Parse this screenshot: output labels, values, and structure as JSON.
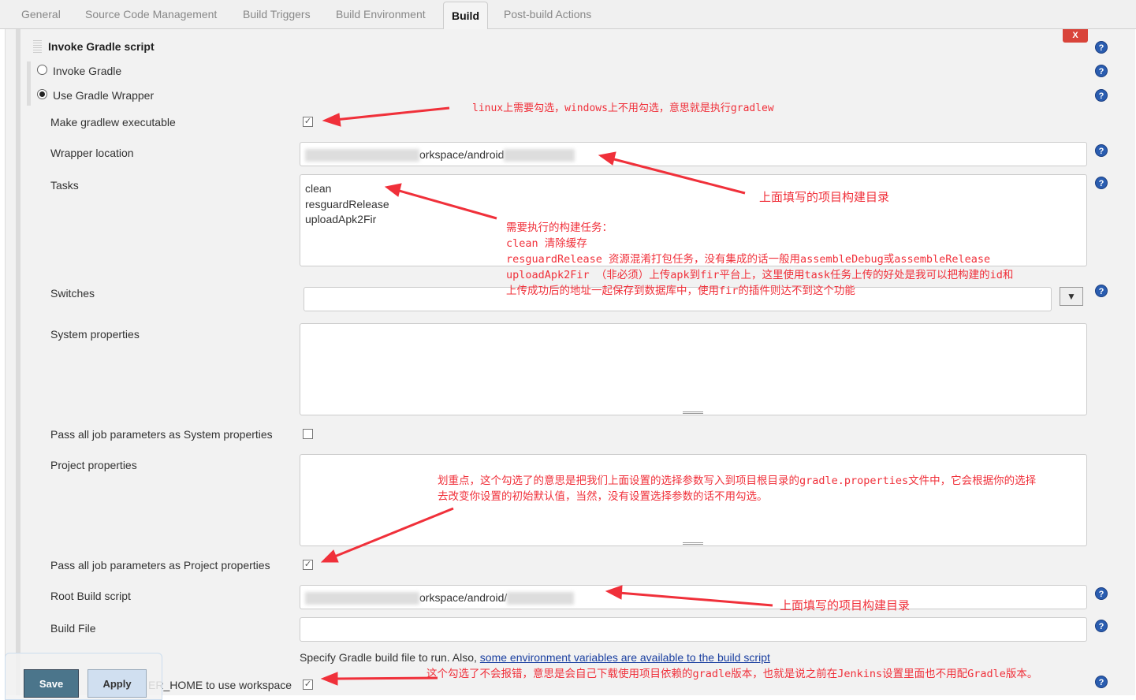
{
  "tabs": [
    {
      "label": "General"
    },
    {
      "label": "Source Code Management"
    },
    {
      "label": "Build Triggers"
    },
    {
      "label": "Build Environment"
    },
    {
      "label": "Build",
      "active": true
    },
    {
      "label": "Post-build Actions"
    }
  ],
  "section": {
    "title": "Invoke Gradle script",
    "delete_label": "X"
  },
  "radios": {
    "invoke_gradle": "Invoke Gradle",
    "use_wrapper": "Use Gradle Wrapper",
    "selected": "use_wrapper"
  },
  "fields": {
    "make_executable": {
      "label": "Make gradlew executable",
      "checked": true
    },
    "wrapper_location": {
      "label": "Wrapper location",
      "value": "orkspace/android"
    },
    "tasks": {
      "label": "Tasks",
      "lines": [
        "clean",
        "resguardRelease",
        "uploadApk2Fir"
      ]
    },
    "switches": {
      "label": "Switches",
      "value": ""
    },
    "system_properties": {
      "label": "System properties",
      "value": ""
    },
    "pass_system": {
      "label": "Pass all job parameters as System properties",
      "checked": false
    },
    "project_properties": {
      "label": "Project properties",
      "value": ""
    },
    "pass_project": {
      "label": "Pass all job parameters as Project properties",
      "checked": true
    },
    "root_build_script": {
      "label": "Root Build script",
      "value": "orkspace/android/"
    },
    "build_file": {
      "label": "Build File",
      "value": ""
    },
    "build_file_help": "Specify Gradle build file to run. Also, ",
    "build_file_link": "some environment variables are available to the build script",
    "gradle_home": {
      "label": "ER_HOME to use workspace",
      "checked": true
    }
  },
  "buttons": {
    "save": "Save",
    "apply": "Apply"
  },
  "annotations": {
    "linux": "linux上需要勾选，windows上不用勾选，意思就是执行gradlew",
    "wrapper_dir": "上面填写的项目构建目录",
    "tasks": [
      "需要执行的构建任务：",
      "clean 清除缓存",
      "resguardRelease 资源混淆打包任务，没有集成的话一般用assembleDebug或assembleRelease",
      "uploadApk2Fir （非必须）上传apk到fir平台上，这里使用task任务上传的好处是我可以把构建的id和",
      "上传成功后的地址一起保存到数据库中，使用fir的插件则达不到这个功能"
    ],
    "project_props": [
      "划重点，这个勾选了的意思是把我们上面设置的选择参数写入到项目根目录的gradle.properties文件中，它会根据你的选择",
      "去改变你设置的初始默认值，当然，没有设置选择参数的话不用勾选。"
    ],
    "root_dir": "上面填写的项目构建目录",
    "gradle_home": "这个勾选了不会报错，意思是会自己下载使用项目依赖的gradle版本，也就是说之前在Jenkins设置里面也不用配Gradle版本。"
  },
  "colors": {
    "annotation": "#f0303a",
    "save_bg": "#4b758b",
    "apply_bg": "#d0dff0",
    "help": "#2a5db0"
  }
}
